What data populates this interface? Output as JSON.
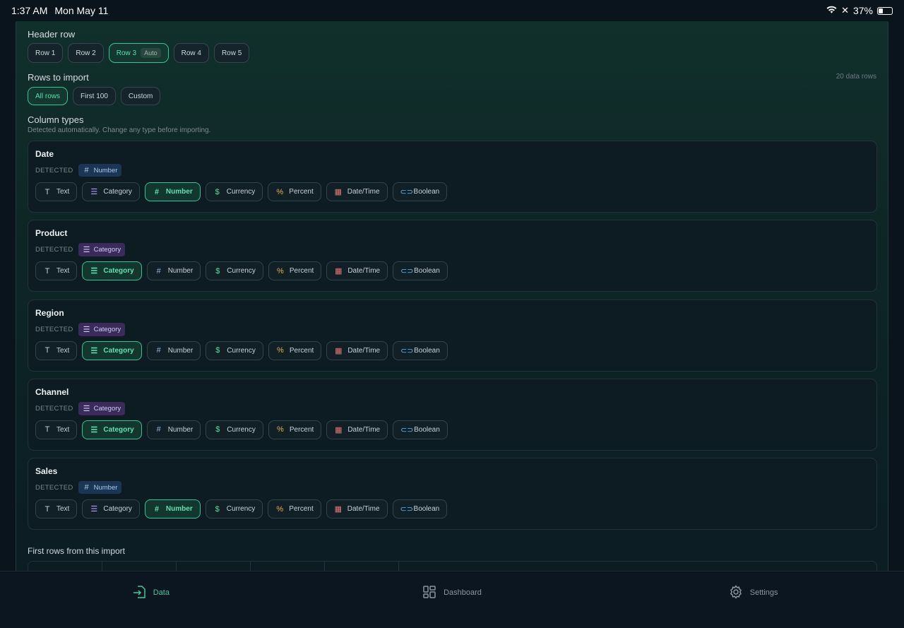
{
  "status": {
    "time": "1:37 AM",
    "date": "Mon May 11",
    "battery": "37%"
  },
  "header_row": {
    "label": "Header row",
    "options": [
      {
        "label": "Row 1",
        "selected": false
      },
      {
        "label": "Row 2",
        "selected": false
      },
      {
        "label": "Row 3",
        "selected": true,
        "tag": "Auto"
      },
      {
        "label": "Row 4",
        "selected": false
      },
      {
        "label": "Row 5",
        "selected": false
      }
    ]
  },
  "rows_to_import": {
    "label": "Rows to import",
    "count_text": "20 data rows",
    "options": [
      {
        "label": "All rows",
        "selected": true
      },
      {
        "label": "First 100",
        "selected": false
      },
      {
        "label": "Custom",
        "selected": false
      }
    ]
  },
  "column_types": {
    "label": "Column types",
    "hint": "Detected automatically. Change any type before importing.",
    "detected_label": "DETECTED",
    "type_options": [
      {
        "key": "text",
        "label": "Text",
        "icon": "text-icon"
      },
      {
        "key": "category",
        "label": "Category",
        "icon": "list-icon"
      },
      {
        "key": "number",
        "label": "Number",
        "icon": "hash-icon"
      },
      {
        "key": "currency",
        "label": "Currency",
        "icon": "dollar-icon"
      },
      {
        "key": "percent",
        "label": "Percent",
        "icon": "percent-icon"
      },
      {
        "key": "datetime",
        "label": "Date/Time",
        "icon": "calendar-icon"
      },
      {
        "key": "boolean",
        "label": "Boolean",
        "icon": "toggle-icon"
      }
    ],
    "columns": [
      {
        "name": "Date",
        "detected": "Number",
        "detected_key": "number",
        "selected": "number"
      },
      {
        "name": "Product",
        "detected": "Category",
        "detected_key": "category",
        "selected": "category"
      },
      {
        "name": "Region",
        "detected": "Category",
        "detected_key": "category",
        "selected": "category"
      },
      {
        "name": "Channel",
        "detected": "Category",
        "detected_key": "category",
        "selected": "category"
      },
      {
        "name": "Sales",
        "detected": "Number",
        "detected_key": "number",
        "selected": "number"
      }
    ]
  },
  "preview": {
    "label": "First rows from this import"
  },
  "tabbar": [
    {
      "label": "Data",
      "icon": "import-icon",
      "active": true
    },
    {
      "label": "Dashboard",
      "icon": "dashboard-icon",
      "active": false
    },
    {
      "label": "Settings",
      "icon": "gear-icon",
      "active": false
    }
  ],
  "colors": {
    "accent": "#42c79a",
    "background": "#0a141d"
  }
}
